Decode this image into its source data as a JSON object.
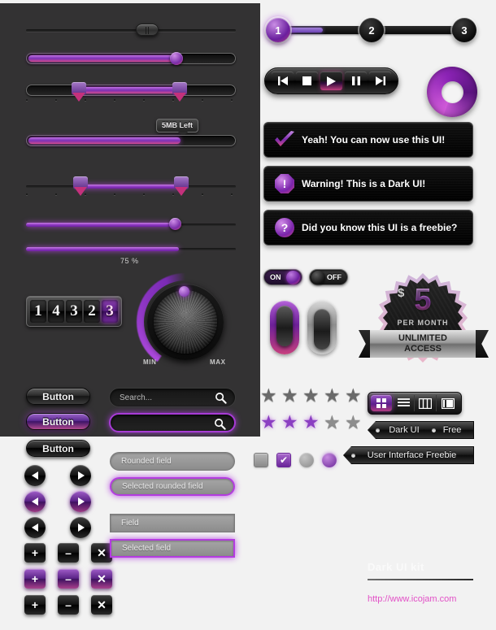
{
  "meta": {
    "title": "Dark UI Kit",
    "accent": "#8b3fc2",
    "accent_pink": "#c7467f",
    "panel_dark": "#333233",
    "page_bg": "#f2f2f2"
  },
  "sliders": {
    "handle_slider_label": "handle-slider",
    "progress_tooltip": "5MB Left",
    "percent_label": "75 %",
    "values": {
      "plain_handle_pct": 57,
      "filled_bar_pct": 78,
      "range_low_pct": 21,
      "range_high_pct": 74,
      "progress_pct": 73,
      "thin_range_low_pct": 21,
      "thin_range_high_pct": 74,
      "thin_round_pct": 70,
      "glow_pct": 73
    }
  },
  "counter": {
    "digits": [
      "1",
      "4",
      "3",
      "2",
      "3"
    ],
    "active_index": 4
  },
  "dial": {
    "min_label": "MIN",
    "max_label": "MAX"
  },
  "buttons": {
    "dark_label": "Button",
    "purple_label": "Button",
    "light_dark_label": "Button"
  },
  "search": {
    "placeholder": "Search...",
    "selected_value": "",
    "icon": "search-icon"
  },
  "fields": [
    {
      "label": "Rounded field",
      "rounded": true,
      "selected": false
    },
    {
      "label": "Selected rounded field",
      "rounded": true,
      "selected": true
    },
    {
      "label": "Field",
      "rounded": false,
      "selected": false
    },
    {
      "label": "Selected field",
      "rounded": false,
      "selected": true
    }
  ],
  "nav_icons": {
    "prev": "◀",
    "next": "▶",
    "plus": "+",
    "minus": "–",
    "close": "✕"
  },
  "steps": {
    "items": [
      {
        "label": "1",
        "active": true
      },
      {
        "label": "2",
        "active": false
      },
      {
        "label": "3",
        "active": false
      }
    ],
    "fill_pct": 22
  },
  "player": {
    "buttons": [
      {
        "name": "prev-track-icon",
        "glyph": "⏮",
        "active": false
      },
      {
        "name": "stop-icon",
        "glyph": "■",
        "active": false
      },
      {
        "name": "play-icon",
        "glyph": "▶",
        "active": true
      },
      {
        "name": "pause-icon",
        "glyph": "❙❙",
        "active": false
      },
      {
        "name": "next-track-icon",
        "glyph": "⏭",
        "active": false
      }
    ]
  },
  "notifications": [
    {
      "icon": "check-icon",
      "glyph": "✔",
      "text": "Yeah! You can now use this UI!",
      "shape": "check"
    },
    {
      "icon": "warning-icon",
      "glyph": "!",
      "text": "Warning! This is a Dark UI!",
      "shape": "octagon"
    },
    {
      "icon": "question-icon",
      "glyph": "?",
      "text": "Did you know this UI is a freebie?",
      "shape": "circle"
    }
  ],
  "toggles": {
    "on_label": "ON",
    "off_label": "OFF"
  },
  "badge": {
    "currency": "$",
    "price": "5",
    "period": "PER MONTH",
    "ribbon_line1": "UNLIMITED",
    "ribbon_line2": "ACCESS"
  },
  "ratings": {
    "row1_filled": 0,
    "row2_filled": 3,
    "total": 5,
    "star_glyph": "★"
  },
  "checkboxes": [
    {
      "name": "checkbox-unchecked",
      "checked": false,
      "type": "checkbox"
    },
    {
      "name": "checkbox-checked",
      "checked": true,
      "type": "checkbox",
      "glyph": "✔"
    },
    {
      "name": "radio-unchecked",
      "checked": false,
      "type": "radio"
    },
    {
      "name": "radio-checked",
      "checked": true,
      "type": "radio"
    }
  ],
  "view_toggle": {
    "options": [
      {
        "name": "grid-view-icon",
        "active": true
      },
      {
        "name": "list-view-icon",
        "active": false
      },
      {
        "name": "columns-view-icon",
        "active": false
      },
      {
        "name": "detail-view-icon",
        "active": false
      }
    ]
  },
  "tags": [
    {
      "label": "Dark UI"
    },
    {
      "label": "Free"
    },
    {
      "label": "User Interface Freebie"
    }
  ],
  "footer": {
    "title": "Dark UI kit",
    "url": "http://www.icojam.com"
  }
}
